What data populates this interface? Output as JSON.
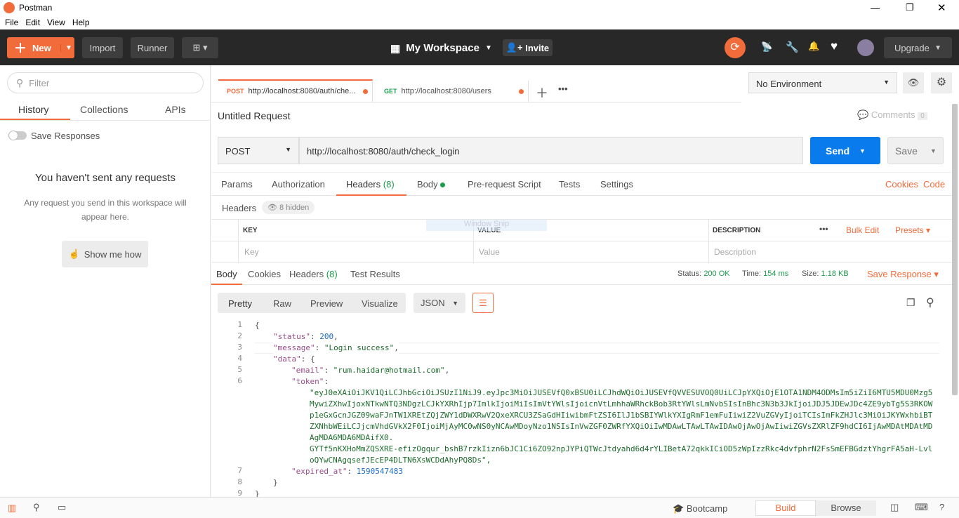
{
  "window": {
    "title": "Postman"
  },
  "menu": [
    "File",
    "Edit",
    "View",
    "Help"
  ],
  "topbar": {
    "new": "New",
    "import": "Import",
    "runner": "Runner",
    "workspace": "My Workspace",
    "invite": "Invite",
    "upgrade": "Upgrade"
  },
  "sidebar": {
    "filter_placeholder": "Filter",
    "tabs": [
      "History",
      "Collections",
      "APIs"
    ],
    "save_responses": "Save Responses",
    "empty_title": "You haven't sent any requests",
    "empty_text": "Any request you send in this workspace will appear here.",
    "show_me": "Show me how"
  },
  "tabs": [
    {
      "method": "POST",
      "url": "http://localhost:8080/auth/che..."
    },
    {
      "method": "GET",
      "url": "http://localhost:8080/users"
    }
  ],
  "environment": "No Environment",
  "request": {
    "title": "Untitled Request",
    "comments": "Comments",
    "comments_count": "0",
    "method": "POST",
    "url": "http://localhost:8080/auth/check_login",
    "send": "Send",
    "save": "Save",
    "tabs": [
      "Params",
      "Authorization",
      "Headers",
      "Body",
      "Pre-request Script",
      "Tests",
      "Settings"
    ],
    "headers_count": "(8)",
    "cookies": "Cookies",
    "code": "Code",
    "headers_label": "Headers",
    "hidden": "8 hidden",
    "columns": [
      "KEY",
      "VALUE",
      "DESCRIPTION"
    ],
    "bulk_edit": "Bulk Edit",
    "presets": "Presets",
    "placeholders": [
      "Key",
      "Value",
      "Description"
    ],
    "overlay": "Window Snip"
  },
  "response": {
    "tabs": [
      "Body",
      "Cookies",
      "Headers",
      "Test Results"
    ],
    "headers_count": "(8)",
    "status_label": "Status:",
    "status": "200 OK",
    "time_label": "Time:",
    "time": "154 ms",
    "size_label": "Size:",
    "size": "1.18 KB",
    "save": "Save Response",
    "views": [
      "Pretty",
      "Raw",
      "Preview",
      "Visualize"
    ],
    "format": "JSON"
  },
  "code_lines": [
    {
      "n": "1",
      "indent": 0,
      "html": "{"
    },
    {
      "n": "2",
      "indent": 1,
      "k": "\"status\"",
      "v": "200",
      "t": "num",
      "tail": ","
    },
    {
      "n": "3",
      "indent": 1,
      "k": "\"message\"",
      "v": "\"Login success\"",
      "t": "str",
      "tail": ","
    },
    {
      "n": "4",
      "indent": 1,
      "k": "\"data\"",
      "v": "{",
      "t": "p",
      "tail": ""
    },
    {
      "n": "5",
      "indent": 2,
      "k": "\"email\"",
      "v": "\"rum.haidar@hotmail.com\"",
      "t": "str",
      "tail": ","
    },
    {
      "n": "6",
      "indent": 2,
      "k": "\"token\"",
      "v": "",
      "t": "p",
      "tail": ""
    },
    {
      "n": "",
      "indent": 3,
      "v": "\"eyJ0eXAiOiJKV1QiLCJhbGciOiJSUzI1NiJ9.eyJpc3MiOiJUSEVfQ0xBSU0iLCJhdWQiOiJUSEVfQVVESUVOQ0UiLCJpYXQiOjE1OTA1NDM4ODMsIm5iZiI6MTU5MDU0Mzg5",
      "t": "str"
    },
    {
      "n": "",
      "indent": 3,
      "v": "MywiZXhwIjoxNTkwNTQ3NDgzLCJkYXRhIjp7ImlkIjoiMiIsImVtYWlsIjoicnVtLmhhaWRhckBob3RtYWlsLmNvbSIsInBhc3N3b3JkIjoiJDJ5JDEwJDc4ZE9ybTg5S3RKOW",
      "t": "str"
    },
    {
      "n": "",
      "indent": 3,
      "v": "p1eGxGcnJGZ09waFJnTW1XREtZQjZWY1dDWXRwV2QxeXRCU3ZSaGdHIiwibmFtZSI6IlJ1bSBIYWlkYXIgRmF1emFuIiwiZ2VuZGVyIjoiTCIsImFkZHJlc3MiOiJKYWxhbiBT",
      "t": "str"
    },
    {
      "n": "",
      "indent": 3,
      "v": "ZXNhbWEiLCJjcmVhdGVkX2F0IjoiMjAyMC0wNS0yNCAwMDoyNzo1NSIsInVwZGF0ZWRfYXQiOiIwMDAwLTAwLTAwIDAwOjAwOjAwIiwiZGVsZXRlZF9hdCI6IjAwMDAtMDAtMD",
      "t": "str"
    },
    {
      "n": "",
      "indent": 3,
      "v": "AgMDA6MDA6MDAifX0.",
      "t": "str"
    },
    {
      "n": "",
      "indent": 3,
      "v": "GYTf5nKXHoMmZQSXRE-efizOgqur_bshB7rzkIizn6bJC1Ci6ZO92npJYPiQTWcJtdyahd6d4rYLIBetA72qkkICiOD5zWpIzzRkc4dvfphrN2FsSmEFBGdztYhgrFA5aH-Lvl",
      "t": "str"
    },
    {
      "n": "",
      "indent": 3,
      "v": "oQYwCNAgqsefJEcEP4DLTN6XsWCDdAhyPQ8Ds\",",
      "t": "str"
    },
    {
      "n": "7",
      "indent": 2,
      "k": "\"expired_at\"",
      "v": "1590547483",
      "t": "num",
      "tail": ""
    },
    {
      "n": "8",
      "indent": 1,
      "html": "}"
    },
    {
      "n": "9",
      "indent": 0,
      "html": "}"
    }
  ],
  "footer": {
    "bootcamp": "Bootcamp",
    "build": "Build",
    "browse": "Browse"
  },
  "colors": {
    "accent": "#f26b3a",
    "send": "#097bed",
    "dark": "#282828"
  }
}
